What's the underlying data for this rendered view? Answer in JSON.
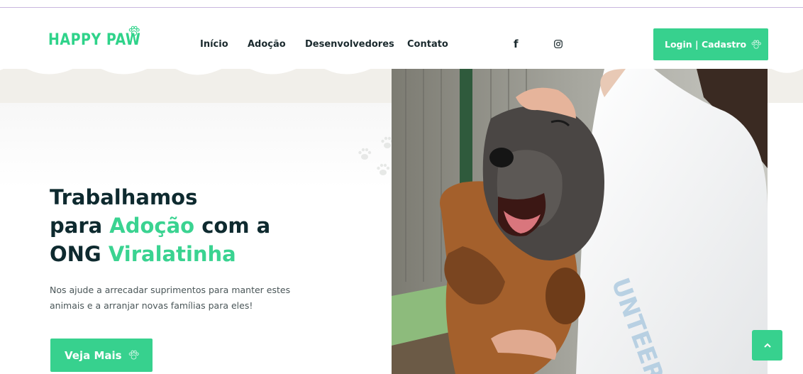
{
  "header": {
    "logo_text": "HAPPY PAW",
    "nav": [
      {
        "label": "Início"
      },
      {
        "label": "Adoção"
      },
      {
        "label": "Desenvolvedores"
      },
      {
        "label": "Contato"
      }
    ],
    "social": {
      "facebook_glyph": "f",
      "icons": [
        "facebook-icon",
        "instagram-icon"
      ]
    },
    "login_label": "Login | Cadastro"
  },
  "hero": {
    "title_line1": "Trabalhamos",
    "title_line2_pre": "para ",
    "title_line2_accent": "Adoção",
    "title_line2_post": " com a",
    "title_line3_pre": "ONG ",
    "title_line3_accent": "Viralatinha",
    "description": "Nos ajude a arrecadar suprimentos para manter estes animais e a arranjar novas famílias para eles!",
    "cta_label": "Veja Mais"
  },
  "colors": {
    "brand_green": "#37d18e",
    "heading_dark": "#0e2a2f",
    "band_beige": "#f1efea"
  }
}
